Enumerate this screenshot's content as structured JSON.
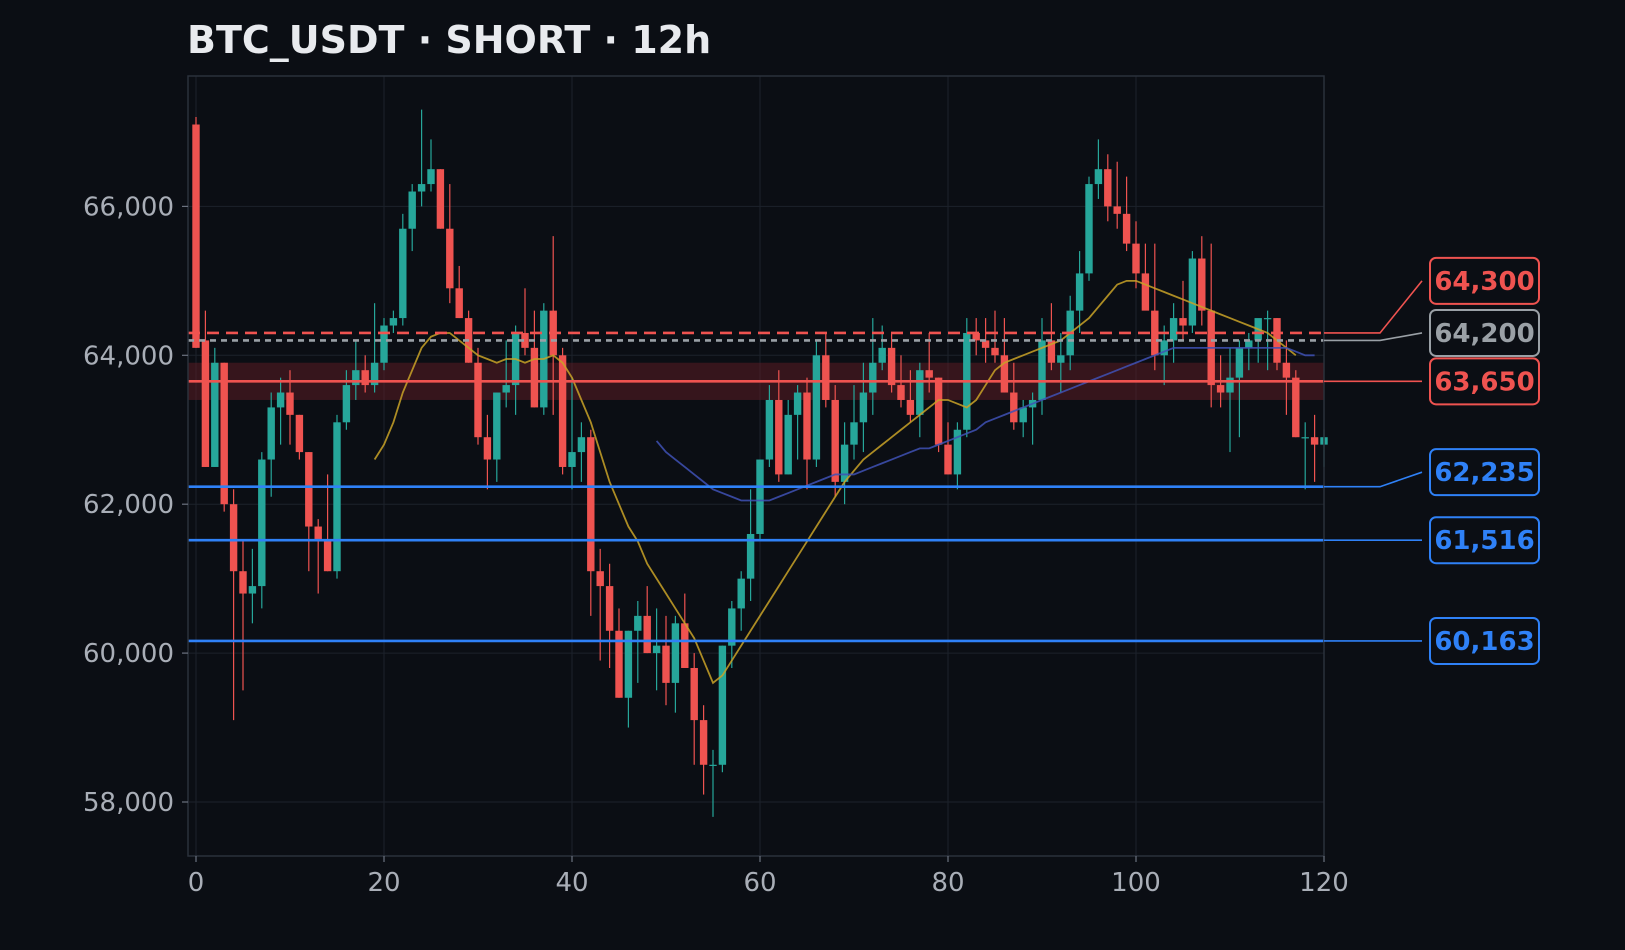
{
  "chart_data": {
    "type": "candlestick",
    "title": "BTC_USDT · SHORT · 12h",
    "xlabel": "",
    "ylabel": "",
    "xlim": [
      -1,
      120
    ],
    "ylim": [
      57300,
      67800
    ],
    "x_ticks": [
      0,
      20,
      40,
      60,
      80,
      100,
      120
    ],
    "y_ticks": [
      58000,
      60000,
      62000,
      64000,
      66000
    ],
    "x_tick_labels": [
      "0",
      "20",
      "40",
      "60",
      "80",
      "100",
      "120"
    ],
    "y_tick_labels": [
      "58,000",
      "60,000",
      "62,000",
      "64,000",
      "66,000"
    ],
    "grid": true,
    "colors": {
      "up": "#26a69a",
      "down": "#ef5350",
      "background": "#0b0e14",
      "ma_fast": "#c9a227",
      "ma_slow": "#3f51b5",
      "support": "#2f81f7",
      "resistance": "#ef5350",
      "neutral": "#9aa0a6"
    },
    "candles": [
      [
        67100,
        67200,
        64100,
        64100
      ],
      [
        64200,
        64600,
        62500,
        62500
      ],
      [
        62500,
        64100,
        62500,
        63900
      ],
      [
        63900,
        63900,
        61900,
        62000
      ],
      [
        62000,
        62200,
        59100,
        61100
      ],
      [
        61100,
        61500,
        59500,
        60800
      ],
      [
        60800,
        61400,
        60400,
        60900
      ],
      [
        60900,
        62700,
        60600,
        62600
      ],
      [
        62600,
        63500,
        62100,
        63300
      ],
      [
        63300,
        63700,
        62800,
        63500
      ],
      [
        63500,
        63800,
        62800,
        63200
      ],
      [
        63200,
        63200,
        62600,
        62700
      ],
      [
        62700,
        62700,
        61100,
        61700
      ],
      [
        61700,
        61800,
        60800,
        61500
      ],
      [
        61500,
        62400,
        61100,
        61100
      ],
      [
        61100,
        63200,
        61000,
        63100
      ],
      [
        63100,
        63800,
        63000,
        63600
      ],
      [
        63600,
        64200,
        63400,
        63800
      ],
      [
        63800,
        64000,
        63500,
        63600
      ],
      [
        63600,
        64700,
        63500,
        63900
      ],
      [
        63900,
        64500,
        63800,
        64400
      ],
      [
        64400,
        64600,
        64300,
        64500
      ],
      [
        64500,
        65900,
        64400,
        65700
      ],
      [
        65700,
        66300,
        65400,
        66200
      ],
      [
        66200,
        67300,
        66000,
        66300
      ],
      [
        66300,
        66900,
        66200,
        66500
      ],
      [
        66500,
        66500,
        65700,
        65700
      ],
      [
        65700,
        66300,
        64700,
        64900
      ],
      [
        64900,
        65200,
        64500,
        64500
      ],
      [
        64500,
        64600,
        63900,
        63900
      ],
      [
        63900,
        64100,
        62800,
        62900
      ],
      [
        62900,
        63200,
        62200,
        62600
      ],
      [
        62600,
        63500,
        62300,
        63500
      ],
      [
        63500,
        64200,
        63300,
        63600
      ],
      [
        63600,
        64400,
        63200,
        64300
      ],
      [
        64300,
        64900,
        64000,
        64100
      ],
      [
        64100,
        64600,
        63300,
        63300
      ],
      [
        63300,
        64700,
        63200,
        64600
      ],
      [
        64600,
        65600,
        63200,
        64000
      ],
      [
        64000,
        64100,
        62400,
        62500
      ],
      [
        62500,
        63700,
        62200,
        62700
      ],
      [
        62700,
        63100,
        62300,
        62900
      ],
      [
        62900,
        63000,
        60500,
        61100
      ],
      [
        61100,
        61400,
        59900,
        60900
      ],
      [
        60900,
        61200,
        59800,
        60300
      ],
      [
        60300,
        60600,
        59400,
        59400
      ],
      [
        59400,
        60300,
        59000,
        60300
      ],
      [
        60300,
        60700,
        59600,
        60500
      ],
      [
        60500,
        60900,
        60000,
        60000
      ],
      [
        60000,
        60600,
        59500,
        60100
      ],
      [
        60100,
        60500,
        59300,
        59600
      ],
      [
        59600,
        60500,
        59200,
        60400
      ],
      [
        60400,
        60800,
        59800,
        59800
      ],
      [
        59800,
        60000,
        58500,
        59100
      ],
      [
        59100,
        59300,
        58100,
        58500
      ],
      [
        58500,
        58700,
        57800,
        58500
      ],
      [
        58500,
        60100,
        58400,
        60100
      ],
      [
        60100,
        60700,
        59800,
        60600
      ],
      [
        60600,
        61100,
        60300,
        61000
      ],
      [
        61000,
        62200,
        60700,
        61600
      ],
      [
        61600,
        62600,
        61500,
        62600
      ],
      [
        62600,
        63600,
        62500,
        63400
      ],
      [
        63400,
        63800,
        62300,
        62400
      ],
      [
        62400,
        63400,
        62400,
        63200
      ],
      [
        63200,
        63600,
        62600,
        63500
      ],
      [
        63500,
        63700,
        62200,
        62600
      ],
      [
        62600,
        64200,
        62500,
        64000
      ],
      [
        64000,
        64300,
        63300,
        63400
      ],
      [
        63400,
        63600,
        62100,
        62300
      ],
      [
        62300,
        63100,
        62000,
        62800
      ],
      [
        62800,
        63600,
        62600,
        63100
      ],
      [
        63100,
        63900,
        62700,
        63500
      ],
      [
        63500,
        64500,
        63200,
        63900
      ],
      [
        63900,
        64400,
        63800,
        64100
      ],
      [
        64100,
        64300,
        63500,
        63600
      ],
      [
        63600,
        64000,
        63300,
        63400
      ],
      [
        63400,
        63800,
        63100,
        63200
      ],
      [
        63200,
        63900,
        62900,
        63800
      ],
      [
        63800,
        64300,
        63500,
        63700
      ],
      [
        63700,
        63700,
        62700,
        62800
      ],
      [
        62800,
        63100,
        62400,
        62400
      ],
      [
        62400,
        63100,
        62200,
        63000
      ],
      [
        63000,
        64500,
        62900,
        64300
      ],
      [
        64300,
        64500,
        64000,
        64200
      ],
      [
        64200,
        64500,
        63900,
        64100
      ],
      [
        64100,
        64600,
        63900,
        64000
      ],
      [
        64000,
        64500,
        63500,
        63500
      ],
      [
        63500,
        63900,
        63000,
        63100
      ],
      [
        63100,
        63400,
        62900,
        63300
      ],
      [
        63300,
        63500,
        62800,
        63400
      ],
      [
        63400,
        64500,
        63200,
        64200
      ],
      [
        64200,
        64700,
        63800,
        63900
      ],
      [
        63900,
        64300,
        63500,
        64000
      ],
      [
        64000,
        64800,
        63800,
        64600
      ],
      [
        64600,
        65400,
        64300,
        65100
      ],
      [
        65100,
        66400,
        65000,
        66300
      ],
      [
        66300,
        66900,
        66100,
        66500
      ],
      [
        66500,
        66700,
        65800,
        66000
      ],
      [
        66000,
        66600,
        65700,
        65900
      ],
      [
        65900,
        66400,
        65400,
        65500
      ],
      [
        65500,
        65800,
        64900,
        65100
      ],
      [
        65100,
        65500,
        64800,
        64600
      ],
      [
        64600,
        65500,
        63800,
        64000
      ],
      [
        64000,
        64400,
        63600,
        64200
      ],
      [
        64200,
        64700,
        63900,
        64500
      ],
      [
        64500,
        65000,
        64200,
        64400
      ],
      [
        64400,
        65400,
        64300,
        65300
      ],
      [
        65300,
        65600,
        64400,
        64600
      ],
      [
        64600,
        65500,
        63300,
        63600
      ],
      [
        63600,
        64000,
        63300,
        63500
      ],
      [
        63500,
        64100,
        62700,
        63700
      ],
      [
        63700,
        64200,
        62900,
        64100
      ],
      [
        64100,
        64300,
        63800,
        64200
      ],
      [
        64200,
        64400,
        63900,
        64500
      ],
      [
        64500,
        64600,
        63800,
        64500
      ],
      [
        64500,
        64500,
        63800,
        63900
      ],
      [
        63900,
        64200,
        63200,
        63700
      ],
      [
        63700,
        63800,
        62900,
        62900
      ],
      [
        62900,
        63100,
        62200,
        62900
      ],
      [
        62900,
        63200,
        62300,
        62800
      ],
      [
        62800,
        63000,
        62500,
        62900
      ]
    ],
    "ma_fast": {
      "start": 19,
      "values": [
        62600,
        62800,
        63100,
        63500,
        63800,
        64100,
        64250,
        64300,
        64300,
        64200,
        64100,
        64000,
        63950,
        63900,
        63950,
        63950,
        63900,
        63950,
        63950,
        64000,
        63900,
        63700,
        63400,
        63100,
        62700,
        62300,
        62000,
        61700,
        61500,
        61200,
        61000,
        60800,
        60600,
        60400,
        60200,
        59900,
        59600,
        59700,
        59900,
        60100,
        60300,
        60500,
        60700,
        60900,
        61100,
        61300,
        61500,
        61700,
        61900,
        62100,
        62300,
        62450,
        62600,
        62700,
        62800,
        62900,
        63000,
        63100,
        63200,
        63300,
        63400,
        63400,
        63350,
        63300,
        63400,
        63600,
        63800,
        63900,
        63950,
        64000,
        64050,
        64100,
        64150,
        64200,
        64300,
        64400,
        64500,
        64650,
        64800,
        64950,
        65000,
        65000,
        64950,
        64900,
        64850,
        64800,
        64750,
        64700,
        64650,
        64600,
        64550,
        64500,
        64450,
        64400,
        64350,
        64300,
        64200,
        64100,
        64000
      ]
    },
    "ma_slow": {
      "start": 49,
      "values": [
        62850,
        62700,
        62600,
        62500,
        62400,
        62300,
        62200,
        62150,
        62100,
        62050,
        62050,
        62050,
        62050,
        62100,
        62150,
        62200,
        62250,
        62300,
        62350,
        62400,
        62400,
        62400,
        62450,
        62500,
        62550,
        62600,
        62650,
        62700,
        62750,
        62750,
        62800,
        62850,
        62900,
        62950,
        63000,
        63100,
        63150,
        63200,
        63250,
        63300,
        63350,
        63400,
        63450,
        63500,
        63550,
        63600,
        63650,
        63700,
        63750,
        63800,
        63850,
        63900,
        63950,
        64000,
        64050,
        64100,
        64100,
        64100,
        64100,
        64100,
        64100,
        64100,
        64100,
        64100,
        64100,
        64100,
        64100,
        64100,
        64050,
        64000,
        64000
      ]
    },
    "levels": [
      {
        "label": "64,300",
        "value": 64300,
        "style": "dashed",
        "color": "#ef5350",
        "box_value": 65000
      },
      {
        "label": "64,200",
        "value": 64200,
        "style": "dotted",
        "color": "#9aa0a6",
        "box_value": 64300
      },
      {
        "label": "63,650",
        "value": 63650,
        "style": "solid",
        "color": "#ef5350",
        "box_value": 63650,
        "band": [
          63400,
          63900
        ]
      },
      {
        "label": "62,235",
        "value": 62235,
        "style": "solid",
        "color": "#2f81f7",
        "box_value": 62430
      },
      {
        "label": "61,516",
        "value": 61516,
        "style": "solid",
        "color": "#2f81f7",
        "box_value": 61516
      },
      {
        "label": "60,163",
        "value": 60163,
        "style": "solid",
        "color": "#2f81f7",
        "box_value": 60163
      }
    ]
  }
}
